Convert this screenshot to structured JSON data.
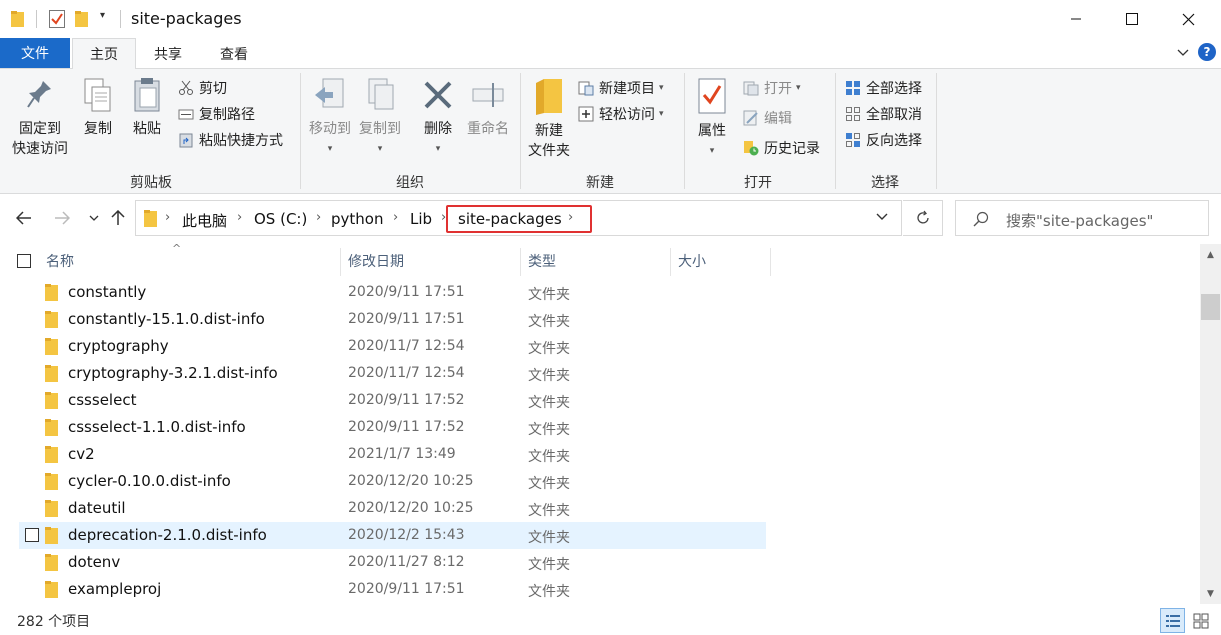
{
  "window": {
    "title": "site-packages",
    "controls": [
      "minimize-icon",
      "maximize-icon",
      "close-icon"
    ]
  },
  "ribbon_tabs": {
    "file": "文件",
    "home": "主页",
    "share": "共享",
    "view": "查看"
  },
  "ribbon": {
    "clipboard": {
      "label": "剪贴板",
      "pin_line1": "固定到",
      "pin_line2": "快速访问",
      "copy": "复制",
      "paste": "粘贴",
      "cut": "剪切",
      "copy_path": "复制路径",
      "paste_shortcut": "粘贴快捷方式"
    },
    "organize": {
      "label": "组织",
      "move_to": "移动到",
      "copy_to": "复制到",
      "delete": "删除",
      "rename": "重命名"
    },
    "new": {
      "label": "新建",
      "new_folder_line1": "新建",
      "new_folder_line2": "文件夹",
      "new_item": "新建项目",
      "easy_access": "轻松访问"
    },
    "open": {
      "label": "打开",
      "properties": "属性",
      "open": "打开",
      "edit": "编辑",
      "history": "历史记录"
    },
    "select": {
      "label": "选择",
      "select_all": "全部选择",
      "select_none": "全部取消",
      "invert": "反向选择"
    }
  },
  "address_bar": {
    "breadcrumbs": [
      "此电脑",
      "OS (C:)",
      "python",
      "Lib",
      "site-packages"
    ],
    "highlight_color": "#e03131"
  },
  "search": {
    "placeholder": "搜索\"site-packages\""
  },
  "columns": {
    "name": "名称",
    "date": "修改日期",
    "type": "类型",
    "size": "大小"
  },
  "files": [
    {
      "name": "constantly",
      "date": "2020/9/11 17:51",
      "type": "文件夹"
    },
    {
      "name": "constantly-15.1.0.dist-info",
      "date": "2020/9/11 17:51",
      "type": "文件夹"
    },
    {
      "name": "cryptography",
      "date": "2020/11/7 12:54",
      "type": "文件夹"
    },
    {
      "name": "cryptography-3.2.1.dist-info",
      "date": "2020/11/7 12:54",
      "type": "文件夹"
    },
    {
      "name": "cssselect",
      "date": "2020/9/11 17:52",
      "type": "文件夹"
    },
    {
      "name": "cssselect-1.1.0.dist-info",
      "date": "2020/9/11 17:52",
      "type": "文件夹"
    },
    {
      "name": "cv2",
      "date": "2021/1/7 13:49",
      "type": "文件夹"
    },
    {
      "name": "cycler-0.10.0.dist-info",
      "date": "2020/12/20 10:25",
      "type": "文件夹"
    },
    {
      "name": "dateutil",
      "date": "2020/12/20 10:25",
      "type": "文件夹"
    },
    {
      "name": "deprecation-2.1.0.dist-info",
      "date": "2020/12/2 15:43",
      "type": "文件夹",
      "hovered": true
    },
    {
      "name": "dotenv",
      "date": "2020/11/27 8:12",
      "type": "文件夹"
    },
    {
      "name": "exampleproj",
      "date": "2020/9/11 17:51",
      "type": "文件夹"
    }
  ],
  "status_bar": {
    "count": "282 个项目"
  },
  "colors": {
    "accent": "#1b6ac9",
    "hover_row": "#e5f3ff",
    "folder": "#f4c542"
  }
}
